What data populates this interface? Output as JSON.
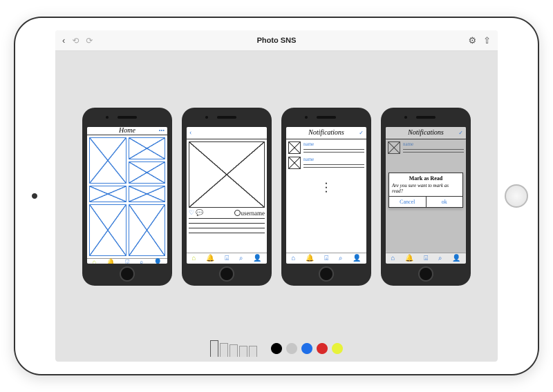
{
  "app": {
    "title": "Photo SNS"
  },
  "toolbar": {
    "back_glyph": "‹",
    "undo_glyph": "⟲",
    "redo_glyph": "⟳",
    "settings_glyph": "⚙",
    "share_glyph": "⇧"
  },
  "mockups": [
    {
      "name": "home",
      "title": "Home",
      "action_glyph": "•••",
      "active_tab": 0
    },
    {
      "name": "detail",
      "back_glyph": "‹",
      "username_label": "username",
      "active_tab": 0
    },
    {
      "name": "notifications",
      "title": "Notifications",
      "check_glyph": "✓",
      "items": [
        {
          "name": "name"
        },
        {
          "name": "name"
        }
      ],
      "active_tab": 1
    },
    {
      "name": "notifications-dialog",
      "title": "Notifications",
      "check_glyph": "✓",
      "items": [
        {
          "name": "name"
        }
      ],
      "dialog": {
        "title": "Mark as Read",
        "message": "Are you sure want to mark as read?",
        "cancel": "Cancel",
        "ok": "ok"
      },
      "active_tab": 1
    }
  ],
  "tab_icons": [
    "⌂",
    "🔔",
    "⌻",
    "⌕",
    "👤"
  ],
  "palette": {
    "swatches": [
      "#000000",
      "#c6c6c6",
      "#1f6fe8",
      "#d82a2a",
      "#e7f23a"
    ]
  }
}
